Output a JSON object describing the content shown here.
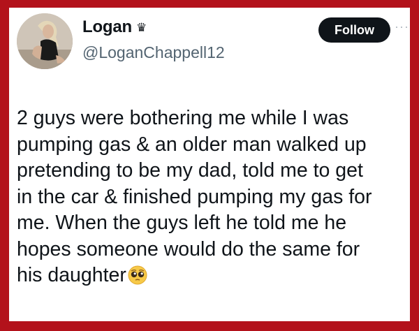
{
  "author": {
    "display_name": "Logan",
    "badge_glyph": "♛",
    "handle": "@LoganChappell12",
    "avatar_icon": "profile-photo"
  },
  "actions": {
    "follow_label": "Follow",
    "more_glyph": "···"
  },
  "tweet": {
    "lines": [
      "2 guys were bothering me while I was",
      "pumping gas & an older man walked up",
      "pretending to be my dad, told me to get",
      "in the car & finished pumping my gas for",
      "me. When the guys left he told me he",
      "hopes someone would do the same for",
      "his daughter"
    ],
    "emoji": "pleading-face-emoji"
  },
  "colors": {
    "background_border": "#b3121b",
    "card": "#ffffff",
    "text": "#0f1419",
    "secondary_text": "#536471",
    "follow_button": "#0f1419"
  }
}
